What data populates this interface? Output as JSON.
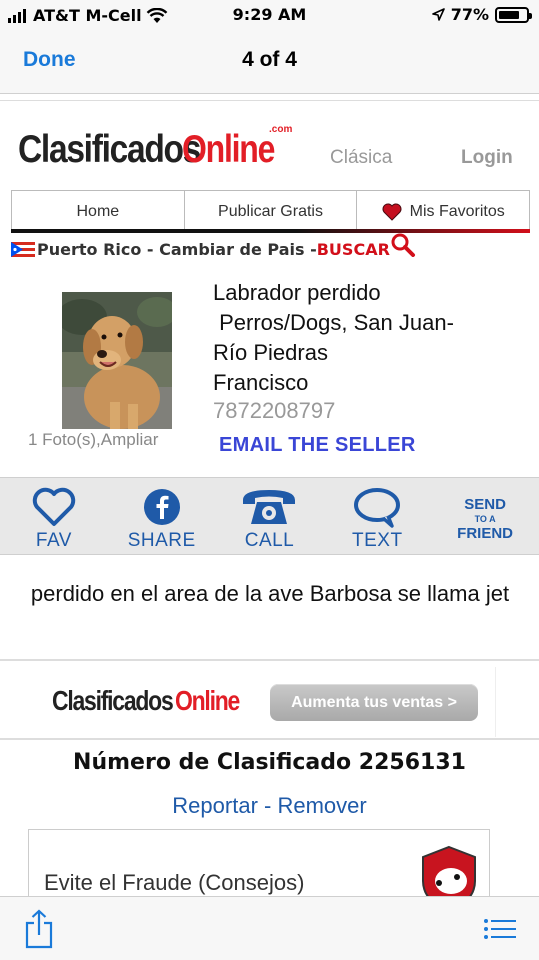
{
  "status_bar": {
    "carrier": "AT&T M-Cell",
    "time": "9:29 AM",
    "battery": "77%",
    "battery_level": 0.77
  },
  "nav": {
    "done_label": "Done",
    "page_count": "4 of 4"
  },
  "site": {
    "logo_main": "Clasificados",
    "logo_online": "Online",
    "logo_com": ".com",
    "clasica_label": "Clásica",
    "login_label": "Login",
    "menu": [
      "Home",
      "Publicar Gratis",
      "Mis Favoritos"
    ],
    "location_text": "Puerto Rico - Cambiar de Pais - ",
    "buscar_label": "BUSCAR"
  },
  "listing": {
    "title_line1": "Labrador perdido",
    "title_line2": " Perros/Dogs, San Juan-",
    "title_line3": "Río Piedras",
    "seller": "Francisco",
    "phone": "7872208797",
    "photo_caption": "1 Foto(s),Ampliar",
    "email_label": "EMAIL THE SELLER",
    "description": "perdido en el area de la ave Barbosa se llama jet",
    "number_label": "Número de Clasificado 2256131",
    "report_label": "Reportar",
    "separator": " - ",
    "remove_label": "Remover",
    "fraud_label": "Evite el Fraude (Consejos)"
  },
  "actions": {
    "fav": "FAV",
    "share": "SHARE",
    "call": "CALL",
    "text": "TEXT",
    "send_line1": "SEND",
    "send_line2": "TO A",
    "send_line3": "FRIEND"
  },
  "ad": {
    "logo_text": "Clasificados",
    "logo_online": "Online",
    "button_label": "Aumenta tus ventas >"
  },
  "colors": {
    "ios_blue": "#1a7ad9",
    "brand_red": "#e21e26",
    "action_blue": "#1f5aa8",
    "email_blue": "#3a46d6"
  }
}
